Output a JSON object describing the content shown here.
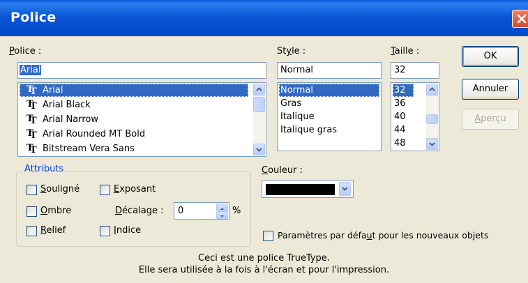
{
  "window": {
    "title": "Police"
  },
  "font": {
    "label_prefix": "",
    "label_hotkey": "P",
    "label_rest": "olice :",
    "value": "Arial",
    "options": [
      "Arial",
      "Arial Black",
      "Arial Narrow",
      "Arial Rounded MT Bold",
      "Bitstream Vera Sans"
    ],
    "selected_index": 0
  },
  "style": {
    "label_prefix": "St",
    "label_hotkey": "y",
    "label_rest": "le :",
    "value": "Normal",
    "options": [
      "Normal",
      "Gras",
      "Italique",
      "Italique gras"
    ],
    "selected_index": 0
  },
  "size": {
    "label_prefix": "",
    "label_hotkey": "T",
    "label_rest": "aille :",
    "value": "32",
    "options": [
      "32",
      "36",
      "40",
      "44",
      "48"
    ],
    "selected_index": 0
  },
  "buttons": {
    "ok": "OK",
    "cancel": "Annuler",
    "preview_hotkey": "A",
    "preview_rest": "perçu"
  },
  "attributes": {
    "legend": "Attributs",
    "underline_hotkey": "S",
    "underline_rest": "ouligné",
    "superscript_hotkey": "E",
    "superscript_rest": "xposant",
    "shadow_hotkey": "O",
    "shadow_rest": "mbre",
    "offset_hotkey": "D",
    "offset_rest": "écalage :",
    "offset_value": "0",
    "offset_unit": "%",
    "emboss_hotkey": "R",
    "emboss_rest": "elief",
    "subscript_hotkey": "I",
    "subscript_rest": "ndice"
  },
  "color": {
    "label_hotkey": "C",
    "label_rest": "ouleur :",
    "value_color": "#000000"
  },
  "defaults": {
    "label_pre": "Paramètres par défa",
    "label_hotkey": "u",
    "label_post": "t pour les nouveaux objets"
  },
  "info": {
    "line1": "Ceci est une police TrueType.",
    "line2": "Elle sera utilisée à la fois à l'écran et pour l'impression."
  },
  "colors": {
    "title_bar": "#0a56d6",
    "selection": "#316ac5",
    "dialog_bg": "#ece9d8"
  },
  "icons": {
    "truetype": "truetype-font-icon",
    "close": "close-icon"
  }
}
